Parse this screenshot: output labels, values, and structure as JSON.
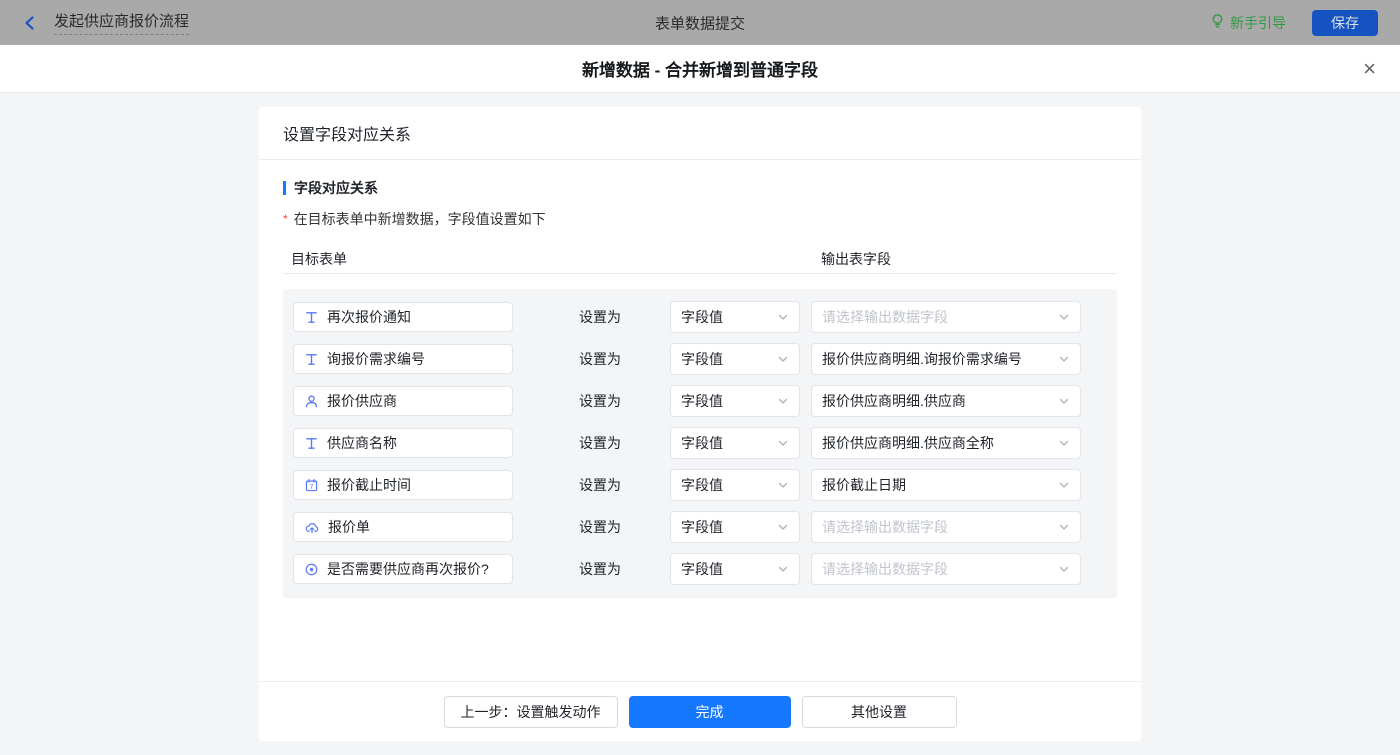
{
  "topbar": {
    "back_title": "发起供应商报价流程",
    "center_title": "表单数据提交",
    "guide_label": "新手引导",
    "save_label": "保存"
  },
  "dialog": {
    "title": "新增数据 - 合并新增到普通字段",
    "close_glyph": "×"
  },
  "card": {
    "header": "设置字段对应关系",
    "section_title": "字段对应关系",
    "required_mark": "*",
    "note": "在目标表单中新增数据，字段值设置如下",
    "col_target": "目标表单",
    "col_output": "输出表字段",
    "set_as_label": "设置为",
    "rows": [
      {
        "icon": "text-field-icon",
        "field": "再次报价通知",
        "mode": "字段值",
        "output": "请选择输出数据字段",
        "is_placeholder": true
      },
      {
        "icon": "text-field-icon",
        "field": "询报价需求编号",
        "mode": "字段值",
        "output": "报价供应商明细.询报价需求编号",
        "is_placeholder": false
      },
      {
        "icon": "person-icon",
        "field": "报价供应商",
        "mode": "字段值",
        "output": "报价供应商明细.供应商",
        "is_placeholder": false
      },
      {
        "icon": "text-field-icon",
        "field": "供应商名称",
        "mode": "字段值",
        "output": "报价供应商明细.供应商全称",
        "is_placeholder": false
      },
      {
        "icon": "calendar-icon",
        "field": "报价截止时间",
        "mode": "字段值",
        "output": "报价截止日期",
        "is_placeholder": false
      },
      {
        "icon": "cloud-upload-icon",
        "field": "报价单",
        "mode": "字段值",
        "output": "请选择输出数据字段",
        "is_placeholder": true
      },
      {
        "icon": "radio-icon",
        "field": "是否需要供应商再次报价?",
        "mode": "字段值",
        "output": "请选择输出数据字段",
        "is_placeholder": true
      }
    ],
    "footer": {
      "prev_label": "上一步：设置触发动作",
      "done_label": "完成",
      "other_label": "其他设置"
    }
  },
  "colors": {
    "accent_blue": "#1677ff",
    "topbar_gray": "#a9a9a9",
    "guide_green": "#2f9a44",
    "icon_blue": "#5b79f5",
    "required_red": "#f5483b",
    "placeholder_gray": "#c0c4cc"
  }
}
